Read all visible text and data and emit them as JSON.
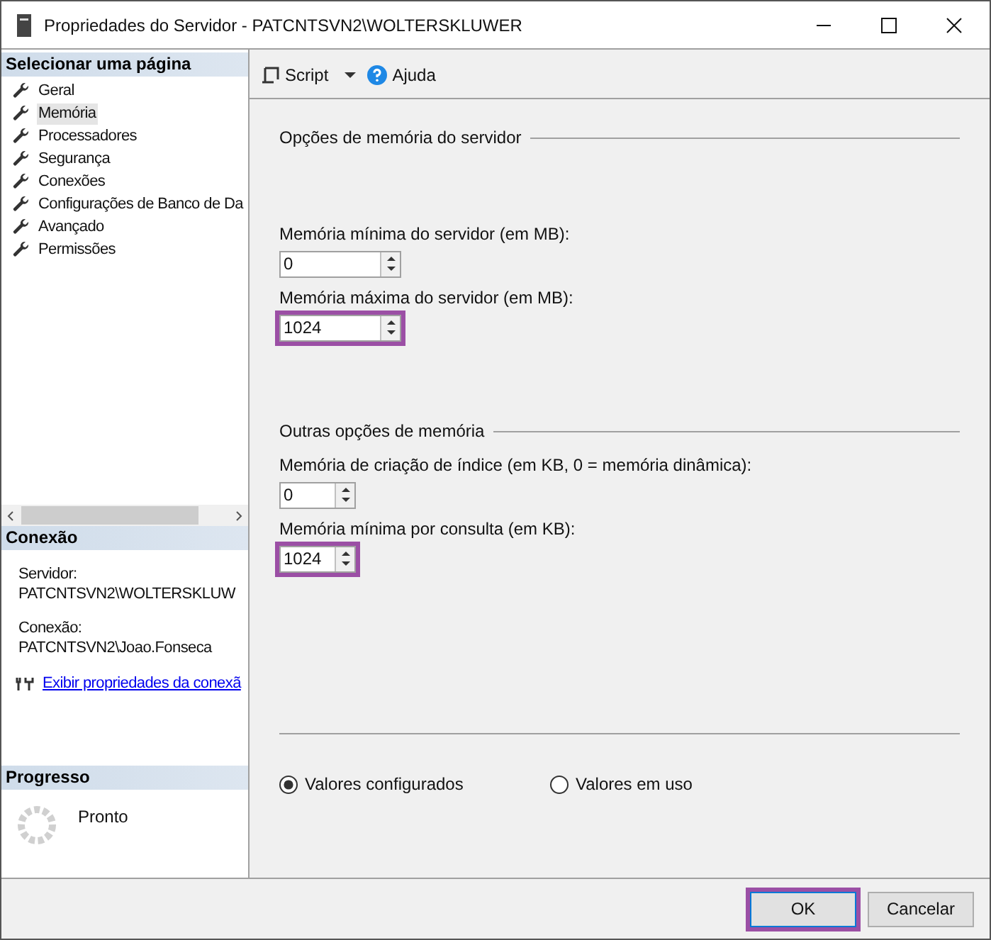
{
  "window": {
    "title": "Propriedades do Servidor - PATCNTSVN2\\WOLTERSKLUWER"
  },
  "sidebar": {
    "header": "Selecionar uma página",
    "items": [
      {
        "label": "Geral",
        "selected": false
      },
      {
        "label": "Memória",
        "selected": true
      },
      {
        "label": "Processadores",
        "selected": false
      },
      {
        "label": "Segurança",
        "selected": false
      },
      {
        "label": "Conexões",
        "selected": false
      },
      {
        "label": "Configurações de Banco de Da",
        "selected": false
      },
      {
        "label": "Avançado",
        "selected": false
      },
      {
        "label": "Permissões",
        "selected": false
      }
    ]
  },
  "connection": {
    "header": "Conexão",
    "server_label": "Servidor:",
    "server": "PATCNTSVN2\\WOLTERSKLUW",
    "connection_label": "Conexão:",
    "connection": "PATCNTSVN2\\Joao.Fonseca",
    "link": "Exibir propriedades da conexã"
  },
  "progress": {
    "header": "Progresso",
    "status": "Pronto"
  },
  "toolbar": {
    "script": "Script",
    "help": "Ajuda"
  },
  "groups": [
    {
      "title": "Opções de memória do servidor",
      "fields": [
        {
          "label": "Memória mínima do servidor (em MB):",
          "value": "0",
          "highlighted": false
        },
        {
          "label": "Memória máxima do servidor (em MB):",
          "value": "1024",
          "highlighted": true
        }
      ]
    },
    {
      "title": "Outras opções de memória",
      "fields": [
        {
          "label": "Memória de criação de índice (em KB, 0 = memória dinâmica):",
          "value": "0",
          "highlighted": false
        },
        {
          "label": "Memória mínima por consulta (em KB):",
          "value": "1024",
          "highlighted": true
        }
      ]
    }
  ],
  "radios": [
    {
      "label": "Valores configurados",
      "selected": true
    },
    {
      "label": "Valores em uso",
      "selected": false
    }
  ],
  "buttons": [
    {
      "label": "OK",
      "highlighted": true
    },
    {
      "label": "Cancelar",
      "highlighted": false
    }
  ]
}
